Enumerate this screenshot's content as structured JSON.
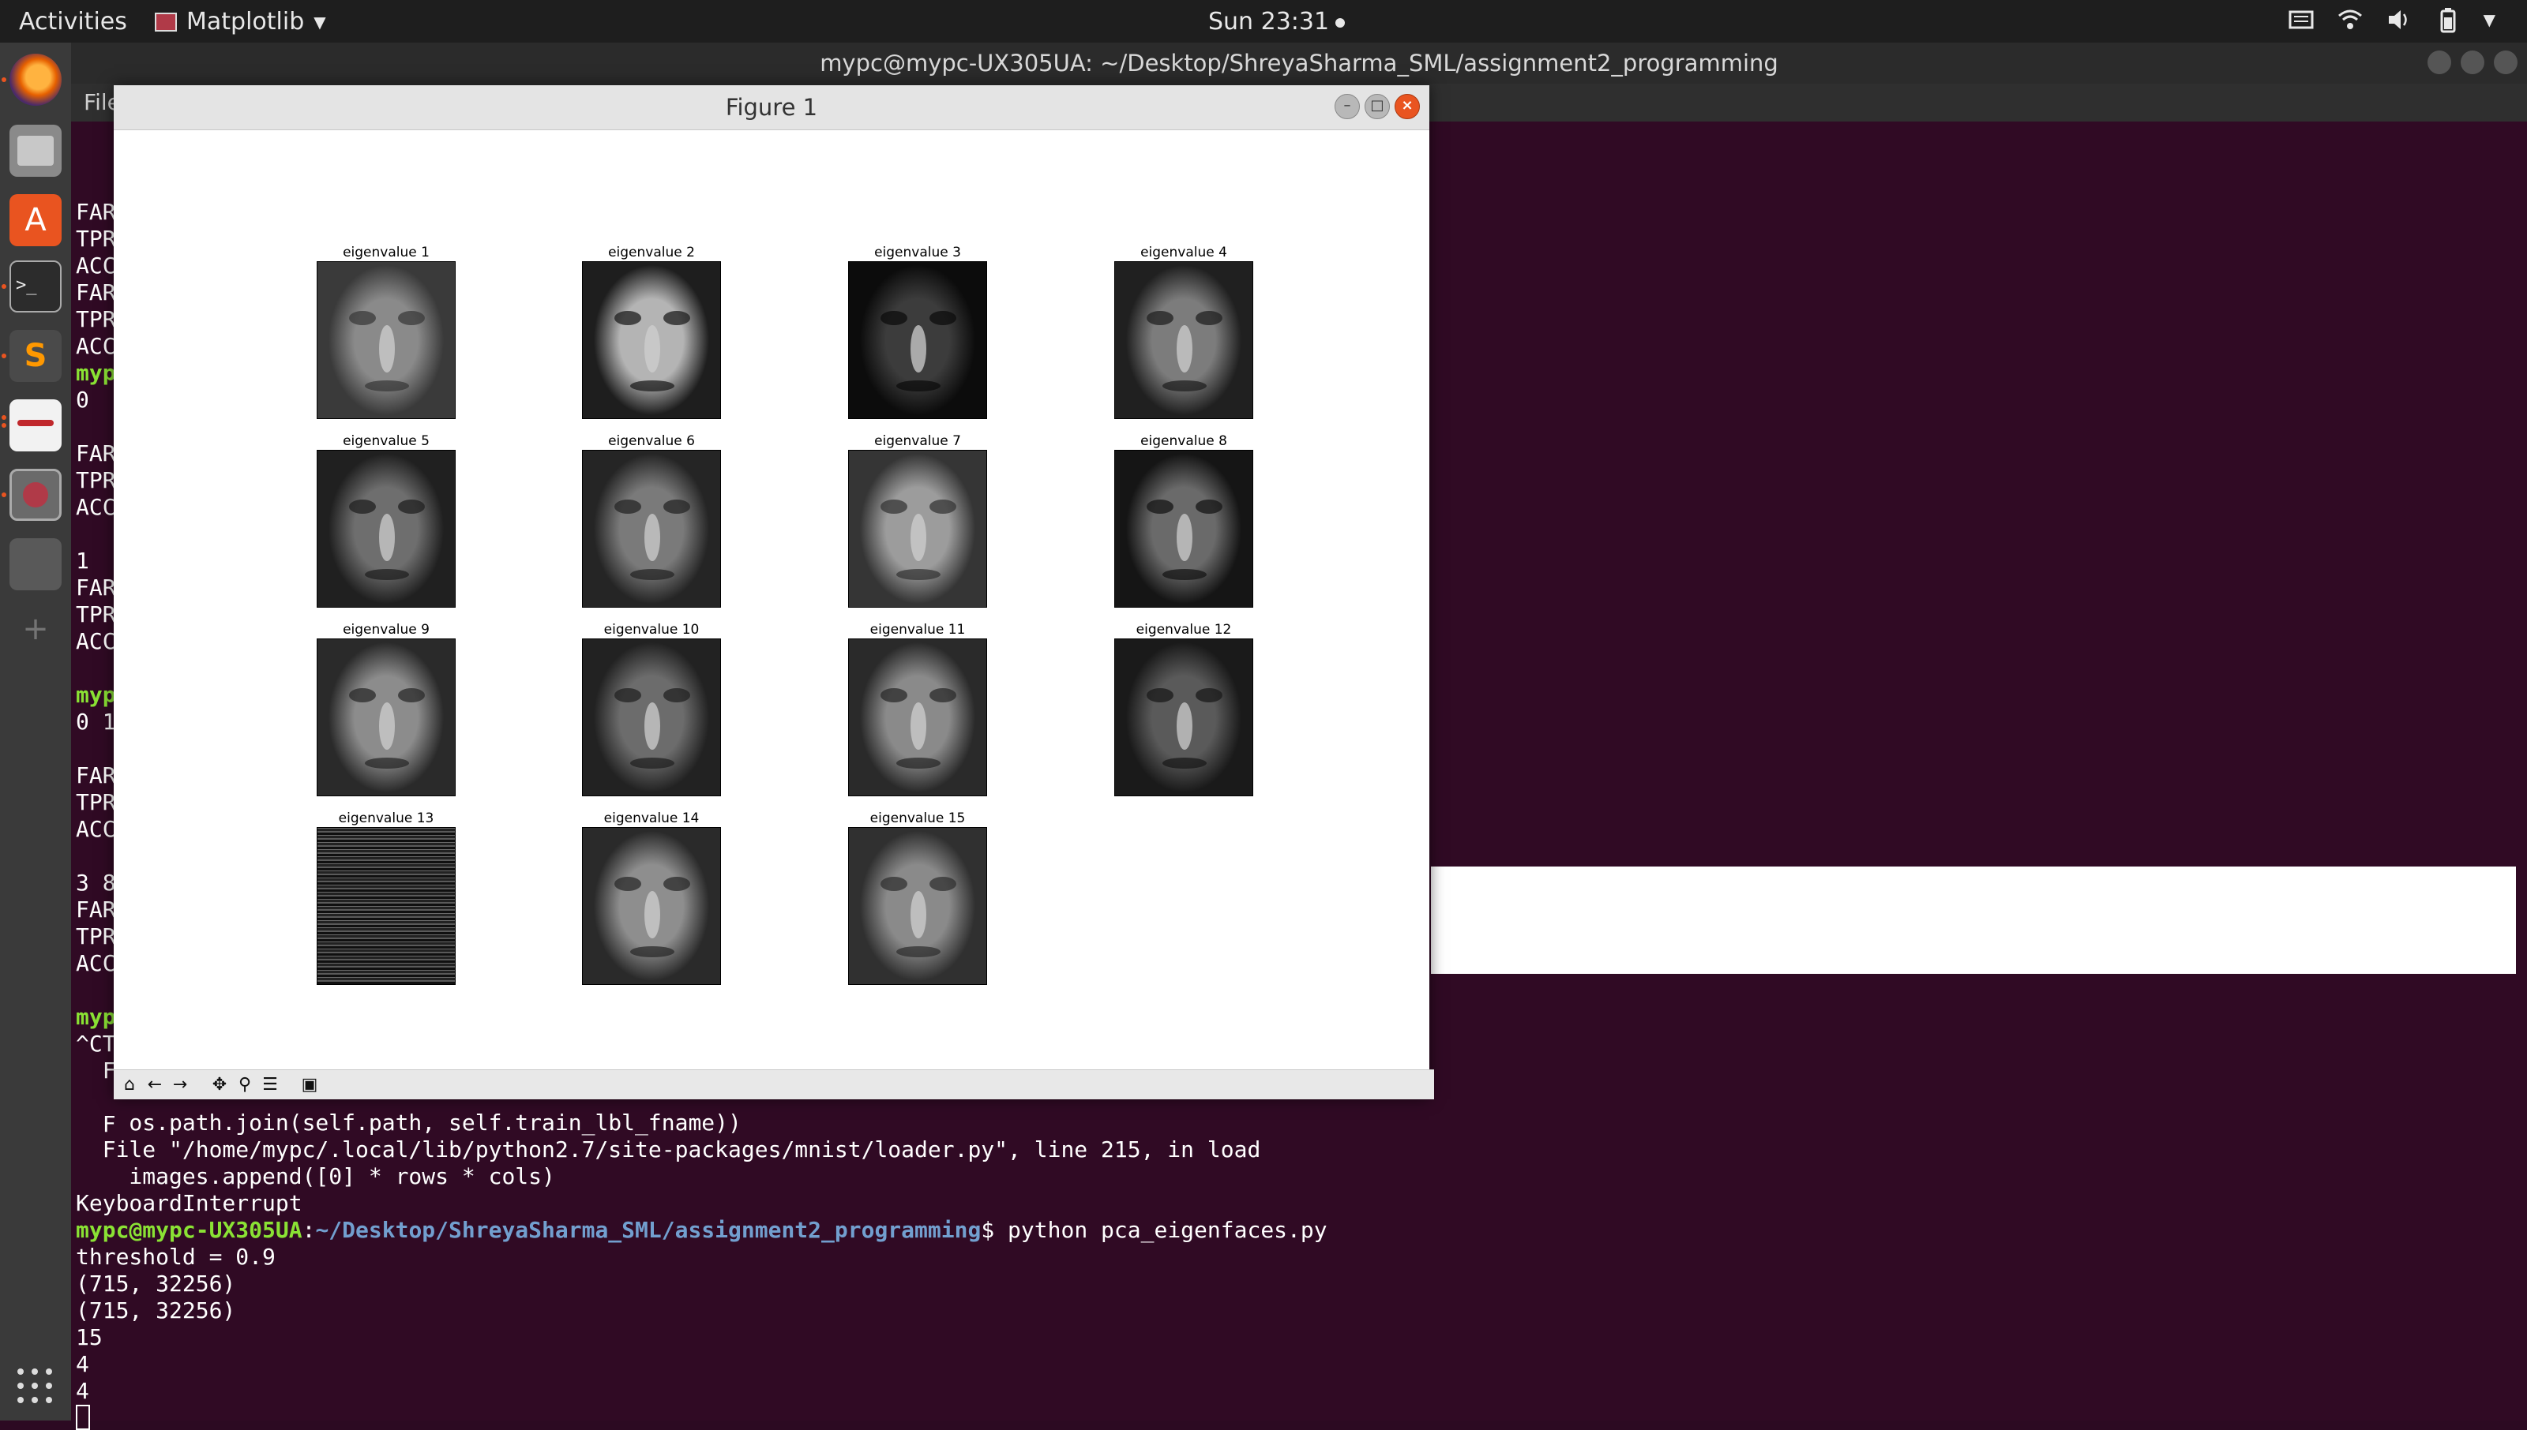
{
  "topbar": {
    "activities": "Activities",
    "app_name": "Matplotlib",
    "clock": "Sun 23:31"
  },
  "dock": {
    "items": [
      "firefox-icon",
      "files-icon",
      "software-center-icon",
      "terminal-icon",
      "sublime-text-icon",
      "document-viewer-icon",
      "screenshot-icon"
    ]
  },
  "terminal": {
    "title": "mypc@mypc-UX305UA: ~/Desktop/ShreyaSharma_SML/assignment2_programming",
    "menu_partial": "File",
    "left_lines": [
      "FAR",
      "TPR",
      "ACC",
      "FAR",
      "TPR",
      "ACC",
      "myp",
      "0",
      "",
      "FAR",
      "TPR",
      "ACC",
      "",
      "1",
      "FAR",
      "TPR",
      "ACC",
      "",
      "myp",
      "0 1",
      "",
      "FAR",
      "TPR",
      "ACC",
      "",
      "3 8",
      "FAR",
      "TPR",
      "ACC",
      "",
      "myp",
      "^CT",
      "  F",
      "",
      "  F"
    ],
    "bottom_lines": [
      "    os.path.join(self.path, self.train_lbl_fname))",
      "  File \"/home/mypc/.local/lib/python2.7/site-packages/mnist/loader.py\", line 215, in load",
      "    images.append([0] * rows * cols)",
      "KeyboardInterrupt"
    ],
    "prompt_user": "mypc@mypc-UX305UA",
    "prompt_path": "~/Desktop/ShreyaSharma_SML/assignment2_programming",
    "command": "$ python pca_eigenfaces.py",
    "output_lines": [
      "threshold = 0.9",
      "(715, 32256)",
      "(715, 32256)",
      "15",
      "4",
      "4"
    ]
  },
  "figure": {
    "title": "Figure 1",
    "panels": [
      {
        "title": "eigenvalue 1",
        "tone": "#8a8a8a",
        "dark": "#3a3a3a"
      },
      {
        "title": "eigenvalue 2",
        "tone": "#b4b4b4",
        "dark": "#1e1e1e"
      },
      {
        "title": "eigenvalue 3",
        "tone": "#3c3c3c",
        "dark": "#0c0c0c"
      },
      {
        "title": "eigenvalue 4",
        "tone": "#7c7c7c",
        "dark": "#202020"
      },
      {
        "title": "eigenvalue 5",
        "tone": "#6e6e6e",
        "dark": "#202020"
      },
      {
        "title": "eigenvalue 6",
        "tone": "#7a7a7a",
        "dark": "#252525"
      },
      {
        "title": "eigenvalue 7",
        "tone": "#9c9c9c",
        "dark": "#353535"
      },
      {
        "title": "eigenvalue 8",
        "tone": "#6a6a6a",
        "dark": "#151515"
      },
      {
        "title": "eigenvalue 9",
        "tone": "#8c8c8c",
        "dark": "#2a2a2a"
      },
      {
        "title": "eigenvalue 10",
        "tone": "#6c6c6c",
        "dark": "#222222"
      },
      {
        "title": "eigenvalue 11",
        "tone": "#8a8a8a",
        "dark": "#2a2a2a"
      },
      {
        "title": "eigenvalue 12",
        "tone": "#5a5a5a",
        "dark": "#1a1a1a"
      },
      {
        "title": "eigenvalue 13",
        "tone": "#3a3a3a",
        "dark": "#101010",
        "noise": true
      },
      {
        "title": "eigenvalue 14",
        "tone": "#8e8e8e",
        "dark": "#2a2a2a"
      },
      {
        "title": "eigenvalue 15",
        "tone": "#8a8a8a",
        "dark": "#303030"
      }
    ],
    "toolbar": [
      "home-icon",
      "back-icon",
      "forward-icon",
      "pan-icon",
      "zoom-icon",
      "subplots-icon",
      "save-icon"
    ]
  },
  "colors": {
    "terminal_bg": "#300a24",
    "prompt_green": "#8ae234",
    "prompt_blue": "#729fcf",
    "close_orange": "#e95420"
  }
}
